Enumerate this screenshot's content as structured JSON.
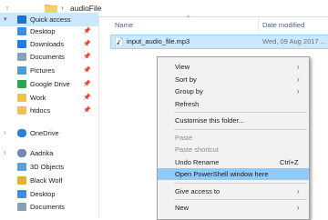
{
  "address": {
    "up_icon": "arrow-up-icon",
    "separator": "›",
    "crumb": "audioFile"
  },
  "nav": {
    "items": [
      {
        "label": "Quick access",
        "icon": "star-icon",
        "color": "#1e6fd0",
        "chevron": "▾",
        "pinned": false,
        "selected": true
      },
      {
        "label": "Desktop",
        "icon": "desktop-folder-icon",
        "color": "#3a8ee6",
        "chevron": "",
        "pinned": true,
        "selected": false
      },
      {
        "label": "Downloads",
        "icon": "downloads-icon",
        "color": "#2b79d6",
        "chevron": "",
        "pinned": true,
        "selected": false
      },
      {
        "label": "Documents",
        "icon": "documents-icon",
        "color": "#8aa0b8",
        "chevron": "",
        "pinned": true,
        "selected": false
      },
      {
        "label": "Pictures",
        "icon": "pictures-icon",
        "color": "#4a9fe0",
        "chevron": "",
        "pinned": true,
        "selected": false
      },
      {
        "label": "Google Drive",
        "icon": "google-drive-icon",
        "color": "#2da44e",
        "chevron": "",
        "pinned": true,
        "selected": false
      },
      {
        "label": "Work",
        "icon": "folder-icon",
        "color": "#f0c14b",
        "chevron": "",
        "pinned": true,
        "selected": false
      },
      {
        "label": "htdocs",
        "icon": "folder-icon",
        "color": "#f0c14b",
        "chevron": "",
        "pinned": true,
        "selected": false
      },
      {
        "label": "OneDrive",
        "icon": "cloud-icon",
        "color": "#2a7fd4",
        "chevron": "›",
        "pinned": false,
        "selected": false
      },
      {
        "label": "Aadrika",
        "icon": "user-icon",
        "color": "#6f8bb0",
        "chevron": "›",
        "pinned": false,
        "selected": false
      },
      {
        "label": "3D Objects",
        "icon": "3d-objects-icon",
        "color": "#5aa0d8",
        "chevron": "",
        "pinned": false,
        "selected": false
      },
      {
        "label": "Black Wolf",
        "icon": "folder-icon",
        "color": "#e0b03a",
        "chevron": "",
        "pinned": false,
        "selected": false
      },
      {
        "label": "Desktop",
        "icon": "desktop-folder-icon",
        "color": "#3a8ee6",
        "chevron": "",
        "pinned": false,
        "selected": false
      },
      {
        "label": "Documents",
        "icon": "documents-icon",
        "color": "#8aa0b8",
        "chevron": "",
        "pinned": false,
        "selected": false
      }
    ],
    "pin_glyph": "📌"
  },
  "columns": {
    "name": "Name",
    "date": "Date modified",
    "sort_glyph": "^"
  },
  "file": {
    "name": "input_audio_file.mp3",
    "date": "Wed, 09 Aug 2017 ..."
  },
  "menu": {
    "items": [
      {
        "label": "View",
        "shortcut": "",
        "arrow": true,
        "disabled": false,
        "highlight": false,
        "sep_after": false
      },
      {
        "label": "Sort by",
        "shortcut": "",
        "arrow": true,
        "disabled": false,
        "highlight": false,
        "sep_after": false
      },
      {
        "label": "Group by",
        "shortcut": "",
        "arrow": true,
        "disabled": false,
        "highlight": false,
        "sep_after": false
      },
      {
        "label": "Refresh",
        "shortcut": "",
        "arrow": false,
        "disabled": false,
        "highlight": false,
        "sep_after": true
      },
      {
        "label": "Customise this folder...",
        "shortcut": "",
        "arrow": false,
        "disabled": false,
        "highlight": false,
        "sep_after": true
      },
      {
        "label": "Paste",
        "shortcut": "",
        "arrow": false,
        "disabled": true,
        "highlight": false,
        "sep_after": false
      },
      {
        "label": "Paste shortcut",
        "shortcut": "",
        "arrow": false,
        "disabled": true,
        "highlight": false,
        "sep_after": false
      },
      {
        "label": "Undo Rename",
        "shortcut": "Ctrl+Z",
        "arrow": false,
        "disabled": false,
        "highlight": false,
        "sep_after": false
      },
      {
        "label": "Open PowerShell window here",
        "shortcut": "",
        "arrow": false,
        "disabled": false,
        "highlight": true,
        "sep_after": true
      },
      {
        "label": "Give access to",
        "shortcut": "",
        "arrow": true,
        "disabled": false,
        "highlight": false,
        "sep_after": true
      },
      {
        "label": "New",
        "shortcut": "",
        "arrow": true,
        "disabled": false,
        "highlight": false,
        "sep_after": false
      }
    ],
    "arrow_glyph": "›"
  }
}
